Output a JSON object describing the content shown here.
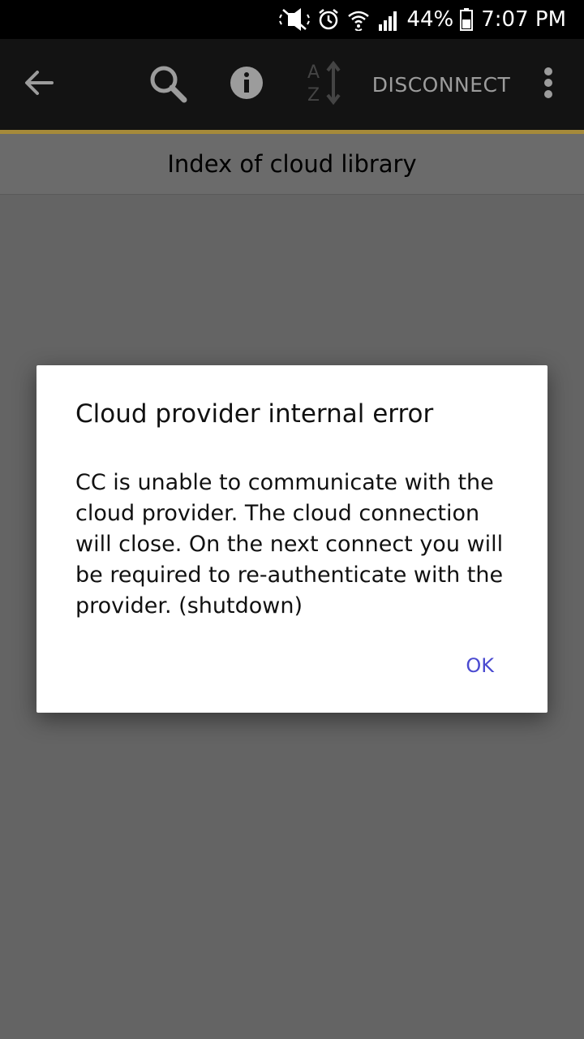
{
  "status_bar": {
    "battery_percent": "44%",
    "time": "7:07 PM",
    "icons": [
      "mute-icon",
      "alarm-icon",
      "wifi-icon",
      "signal-icon",
      "battery-icon"
    ]
  },
  "toolbar": {
    "disconnect_label": "DISCONNECT",
    "icons": [
      "back-arrow-icon",
      "search-icon",
      "info-icon",
      "sort-az-icon",
      "overflow-menu-icon"
    ],
    "accent_color": "#a58a3a"
  },
  "subheader": {
    "title": "Index of cloud library"
  },
  "dialog": {
    "title": "Cloud provider internal error",
    "message": "CC is unable to communicate with the cloud provider. The cloud connection will close. On the next connect you will be required to re-authenticate with the provider. (shutdown)",
    "ok_label": "OK",
    "ok_color": "#4a4ad0"
  }
}
